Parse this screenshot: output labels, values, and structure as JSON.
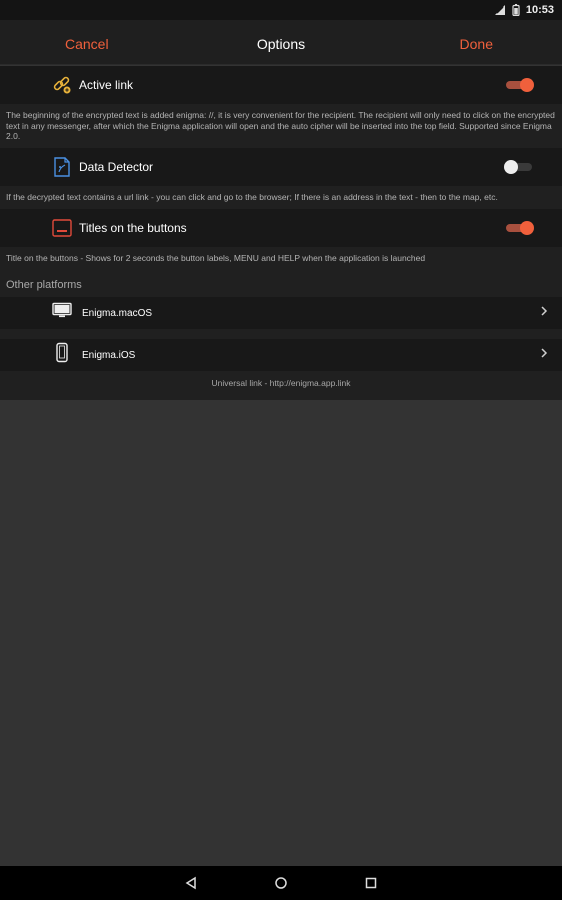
{
  "status_bar": {
    "time": "10:53"
  },
  "navbar": {
    "cancel": "Cancel",
    "title": "Options",
    "done": "Done"
  },
  "settings": [
    {
      "label": "Active link",
      "icon": "link-icon",
      "enabled": true,
      "description": "The beginning of the encrypted text is added enigma: //, it is very convenient for the recipient. The recipient will only need to click on the encrypted text in any messenger, after which the Enigma application will open and the auto cipher will be inserted into the top field. Supported since Enigma 2.0."
    },
    {
      "label": "Data Detector",
      "icon": "document-detector-icon",
      "enabled": false,
      "description": "If the decrypted text contains a url link - you can click and go to the browser; If there is an address in the text - then to the map, etc."
    },
    {
      "label": "Titles on the buttons",
      "icon": "button-titles-icon",
      "enabled": true,
      "description": "Title on the buttons - Shows for 2 seconds the button labels, MENU and HELP when the application is launched"
    }
  ],
  "other_platforms": {
    "header": "Other platforms",
    "items": [
      {
        "label": "Enigma.macOS",
        "icon": "desktop-icon"
      },
      {
        "label": "Enigma.iOS",
        "icon": "phone-icon"
      }
    ]
  },
  "footer": {
    "universal_link": "Universal link - http://enigma.app.link"
  },
  "colors": {
    "accent": "#f0603c",
    "background": "#333333",
    "row": "#181818"
  }
}
